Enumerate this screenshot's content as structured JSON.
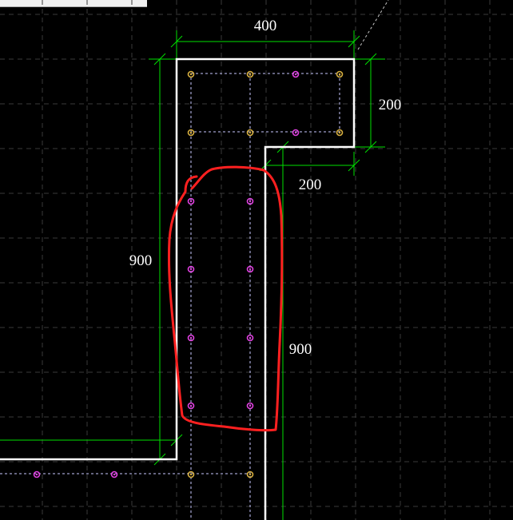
{
  "dimensions": {
    "top_width": "400",
    "right_height": "200",
    "inner_step": "200",
    "left_height": "900",
    "inner_height": "900"
  },
  "colors": {
    "background": "#000000",
    "grid": "#3a3a3a",
    "dimension_line": "#00e000",
    "outline": "#ffffff",
    "rebar_magenta": "#e040e0",
    "rebar_yellow": "#d8b040",
    "markup": "#ff2020",
    "stirrup": "#c8c8ff"
  }
}
